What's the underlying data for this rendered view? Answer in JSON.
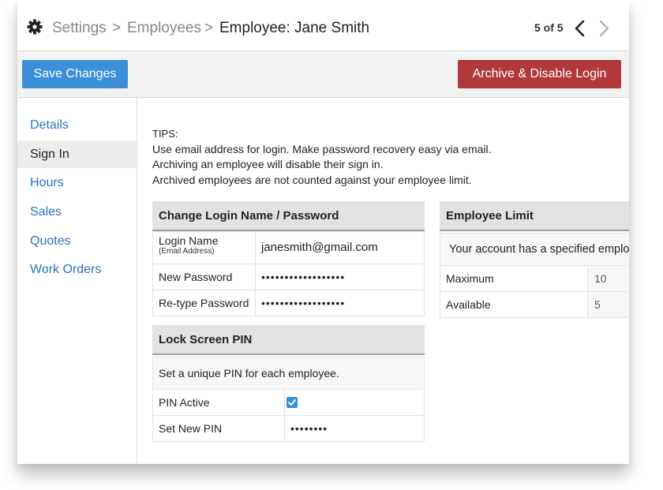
{
  "header": {
    "breadcrumb": [
      "Settings",
      "Employees",
      "Employee: Jane Smith"
    ],
    "separator": ">",
    "pager": "5 of 5",
    "icons": {
      "settings": "gear-icon",
      "prev": "chevron-left-icon",
      "next": "chevron-right-icon"
    }
  },
  "toolbar": {
    "save_label": "Save Changes",
    "archive_label": "Archive & Disable Login"
  },
  "sidebar": {
    "items": [
      {
        "label": "Details"
      },
      {
        "label": "Sign In",
        "active": true
      },
      {
        "label": "Hours"
      },
      {
        "label": "Sales"
      },
      {
        "label": "Quotes"
      },
      {
        "label": "Work Orders"
      }
    ]
  },
  "tips": {
    "heading": "TIPS:",
    "lines": [
      "Use email address for login. Make password recovery easy via email.",
      "Archiving an employee will disable their sign in.",
      "Archived employees are not counted against your employee limit."
    ]
  },
  "login_panel": {
    "title": "Change Login Name / Password",
    "login_label": "Login Name",
    "login_sublabel": "(Email Address)",
    "login_value": "janesmith@gmail.com",
    "new_password_label": "New Password",
    "new_password_value": "••••••••••••••••••",
    "retype_password_label": "Re-type Password",
    "retype_password_value": "••••••••••••••••••"
  },
  "pin_panel": {
    "title": "Lock Screen PIN",
    "note": "Set a unique PIN for each employee.",
    "active_label": "PIN Active",
    "active_checked": true,
    "new_pin_label": "Set New PIN",
    "new_pin_value": "••••••••"
  },
  "limit_panel": {
    "title": "Employee Limit",
    "note": "Your account has a specified emplo",
    "maximum_label": "Maximum",
    "maximum_value": "10",
    "available_label": "Available",
    "available_value": "5"
  },
  "colors": {
    "primary": "#3b8fd9",
    "danger": "#b1393a",
    "link": "#2a73c0"
  }
}
